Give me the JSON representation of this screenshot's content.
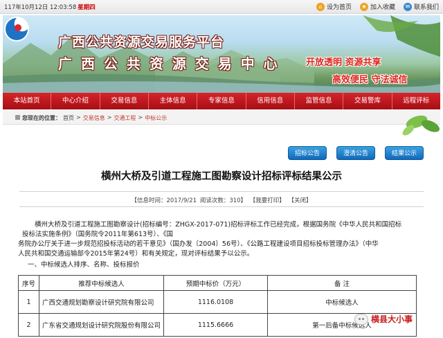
{
  "topbar": {
    "date": "117年10月12日 12:03:58",
    "weekday": "星期四",
    "links": [
      "设为首页",
      "加入收藏",
      "联系我们"
    ]
  },
  "banner": {
    "title_line1": "广西公共资源交易服务平台",
    "title_line2": "广 西 公 共 资 源 交 易 中 心",
    "slogan_line1": "开放透明  资源共享",
    "slogan_line2": "高效便民  守法诚信"
  },
  "nav": {
    "items": [
      "本站首页",
      "中心介绍",
      "交易信息",
      "主体信息",
      "专家信息",
      "信用信息",
      "监管信息",
      "交易警库",
      "远程评标"
    ]
  },
  "breadcrumb": {
    "label": "您现在的位置：",
    "items": [
      "首页",
      ">",
      "交易信息",
      ">",
      "交通工程",
      ">",
      "中标公示"
    ]
  },
  "tabs": [
    "招标公告",
    "澄清公告",
    "结果公示"
  ],
  "article": {
    "title": "横州大桥及引道工程施工图勘察设计招标评标结果公示",
    "meta": {
      "publish": "【信息时间：2017/9/21",
      "views": "阅读次数：310】",
      "print": "【我要打印】",
      "close": "【关闭】"
    },
    "paragraph": [
      "横州大桥及引道工程施工图勘察设计(招标编号：ZHGX-2017-071)招标评标工作已经完成，根据国务院《中华人民共和国招标",
      "投标法实施条例》（国务院令2011年第613号）、《国",
      "务院办公厅关于进一步规范招投标活动的若干意见》（国办发〔2004〕56号）、《公路工程建设项目招标投标管理办法》（中华",
      "人民共和国交通运输部令2015年第24号）和有关规定，现对评标结果予以公示。"
    ],
    "section_heading": "一、中标候选人排序、名称、投标报价"
  },
  "table": {
    "headers": [
      "序号",
      "推荐中标候选人",
      "预期中标价（万元）",
      "备  注"
    ],
    "rows": [
      [
        "1",
        "广西交通规划勘察设计研究院有限公司",
        "1116.0108",
        "中标候选人"
      ],
      [
        "2",
        "广东省交通规划设计研究院股份有限公司",
        "1115.6666",
        "第一后备中标候选人"
      ]
    ]
  },
  "watermark": "横县大小事"
}
